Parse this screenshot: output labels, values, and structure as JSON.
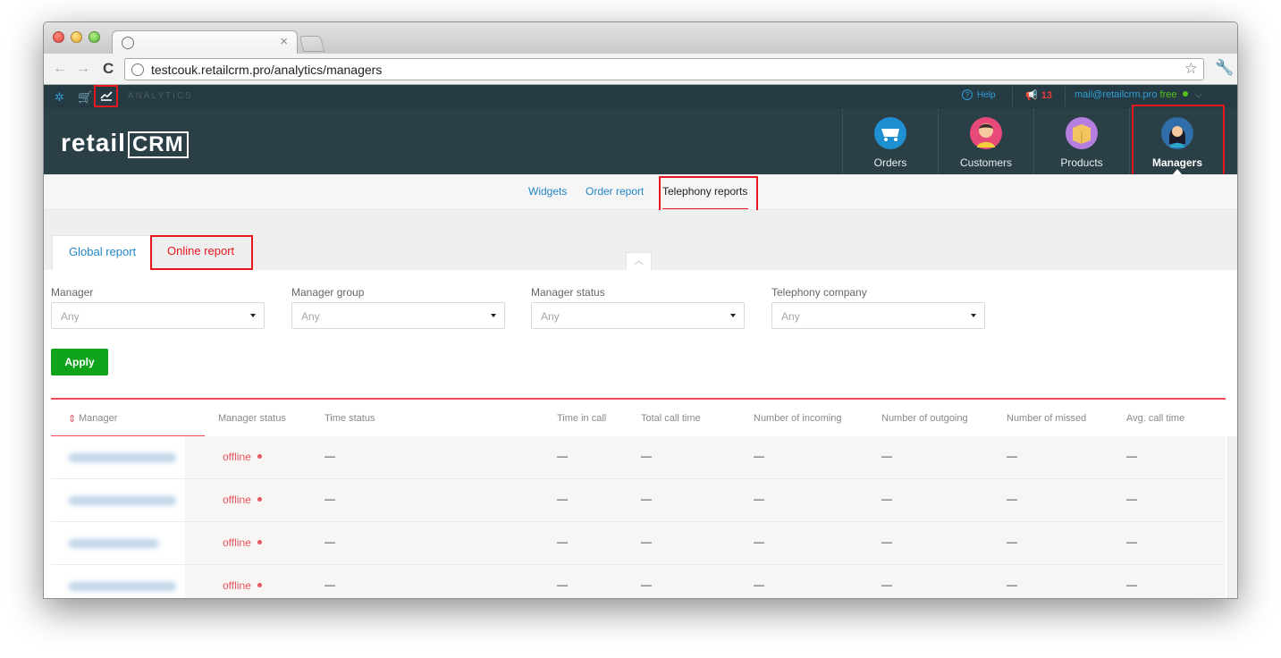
{
  "browser": {
    "address": "testcouk.retailcrm.pro/analytics/managers"
  },
  "topbar": {
    "section": "ANALYTICS",
    "help": "Help",
    "notifications": "13",
    "email": "mail@retailcrm.pro",
    "plan": "free"
  },
  "brand": {
    "prefix": "retail",
    "suffix": "CRM"
  },
  "main_nav": [
    {
      "label": "Orders",
      "color": "#1e8fd0"
    },
    {
      "label": "Customers",
      "color": "#e84a7a"
    },
    {
      "label": "Products",
      "color": "#b57ee0"
    },
    {
      "label": "Managers",
      "color": "#2f6ea8"
    }
  ],
  "subnav": {
    "items": [
      "Widgets",
      "Order report",
      "Telephony reports"
    ]
  },
  "tabs": [
    "Global report",
    "Online report"
  ],
  "filters": [
    {
      "label": "Manager",
      "value": "Any"
    },
    {
      "label": "Manager group",
      "value": "Any"
    },
    {
      "label": "Manager status",
      "value": "Any"
    },
    {
      "label": "Telephony company",
      "value": "Any"
    }
  ],
  "apply_label": "Apply",
  "table": {
    "columns": [
      "Manager",
      "Manager status",
      "Time status",
      "Time in call",
      "Total call time",
      "Number of incoming",
      "Number of outgoing",
      "Number of missed",
      "Avg. call time"
    ],
    "rows": [
      {
        "status": "offline",
        "cells": [
          "—",
          "—",
          "—",
          "—",
          "—",
          "—",
          "—"
        ]
      },
      {
        "status": "offline",
        "cells": [
          "—",
          "—",
          "—",
          "—",
          "—",
          "—",
          "—"
        ]
      },
      {
        "status": "offline",
        "cells": [
          "—",
          "—",
          "—",
          "—",
          "—",
          "—",
          "—"
        ]
      },
      {
        "status": "offline",
        "cells": [
          "—",
          "—",
          "—",
          "—",
          "—",
          "—",
          "—"
        ]
      }
    ]
  }
}
